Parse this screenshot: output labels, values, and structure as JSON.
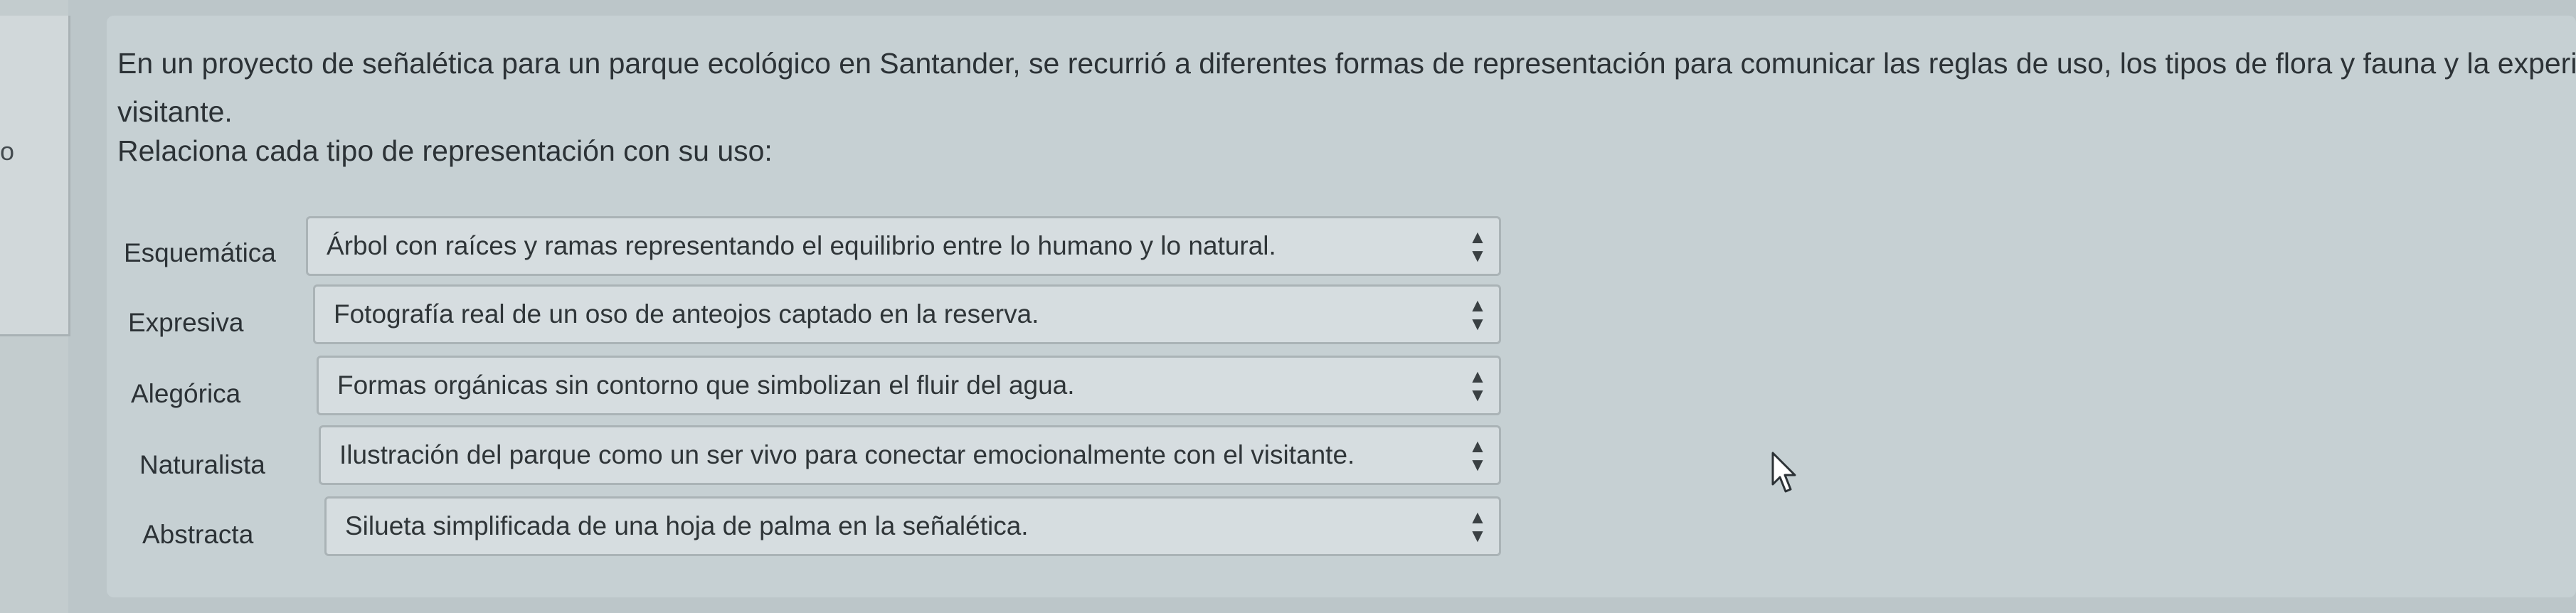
{
  "sidebar": {
    "marker": "o"
  },
  "question": {
    "text": "En un proyecto de señalética para un parque ecológico en Santander, se recurrió a diferentes formas de representación para comunicar las reglas de uso, los tipos de flora y fauna y la experiencia del visitante.",
    "line1": "En un proyecto de señalética para un parque ecológico en Santander, se recurrió a diferentes formas de representación para comunicar las reglas de uso, los tipos de flora y fauna y la experiencia",
    "line2": "visitante.",
    "instruction": "Relaciona cada tipo de representación con su uso:"
  },
  "matches": [
    {
      "label": "Esquemática",
      "selected": "Árbol con raíces y ramas representando el equilibrio entre lo humano y lo natural."
    },
    {
      "label": "Expresiva",
      "selected": "Fotografía real de un oso de anteojos captado en la reserva."
    },
    {
      "label": "Alegórica",
      "selected": "Formas orgánicas sin contorno que simbolizan el fluir del agua."
    },
    {
      "label": "Naturalista",
      "selected": "Ilustración del parque como un ser vivo para conectar emocionalmente con el visitante."
    },
    {
      "label": "Abstracta",
      "selected": "Silueta simplificada de una hoja de palma en la señalética."
    }
  ],
  "icons": {
    "select_arrow": "up-down-chevron-icon",
    "cursor": "mouse-pointer-icon"
  }
}
